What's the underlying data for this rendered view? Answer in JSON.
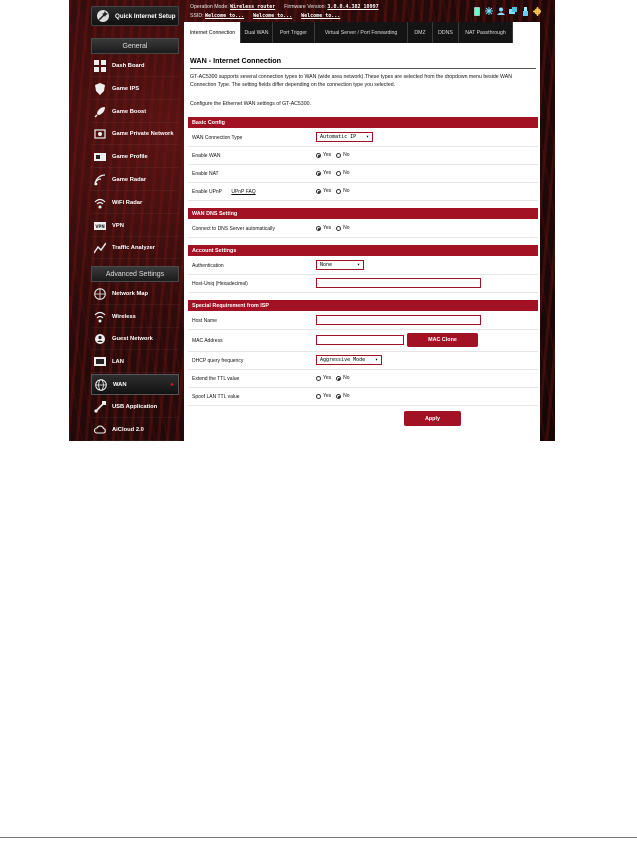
{
  "header": {
    "operation_mode_label": "Operation Mode:",
    "operation_mode_value": "Wireless router",
    "firmware_label": "Firmware Version:",
    "firmware_value": "3.0.0.4.382_10997",
    "ssid_label": "SSID:",
    "ssid_values": [
      "Welcome to...",
      "Welcome to...",
      "Welcome to..."
    ],
    "status_icons": [
      "sim-icon",
      "snowflake-icon",
      "user-icon",
      "network-icon",
      "usb-icon",
      "gear-icon"
    ]
  },
  "sidebar": {
    "quick_setup": "Quick Internet Setup",
    "general_heading": "General",
    "general_items": [
      {
        "label": "Dash Board",
        "icon": "dashboard-icon"
      },
      {
        "label": "Game IPS",
        "icon": "shield-icon"
      },
      {
        "label": "Game Boost",
        "icon": "rocket-icon"
      },
      {
        "label": "Game Private Network",
        "icon": "private-network-icon"
      },
      {
        "label": "Game Profile",
        "icon": "profile-icon"
      },
      {
        "label": "Game Radar",
        "icon": "radar-icon"
      },
      {
        "label": "WiFi Radar",
        "icon": "wifi-radar-icon"
      },
      {
        "label": "VPN",
        "icon": "vpn-icon"
      },
      {
        "label": "Traffic Analyzer",
        "icon": "traffic-icon"
      }
    ],
    "advanced_heading": "Advanced Settings",
    "advanced_items": [
      {
        "label": "Network Map",
        "icon": "network-map-icon"
      },
      {
        "label": "Wireless",
        "icon": "wireless-icon"
      },
      {
        "label": "Guest Network",
        "icon": "guest-network-icon"
      },
      {
        "label": "LAN",
        "icon": "lan-icon"
      },
      {
        "label": "WAN",
        "icon": "globe-icon",
        "active": true
      },
      {
        "label": "USB Application",
        "icon": "usb-app-icon"
      },
      {
        "label": "AiCloud 2.0",
        "icon": "cloud-icon"
      }
    ]
  },
  "tabs": [
    {
      "label": "Internet Connection",
      "active": true
    },
    {
      "label": "Dual WAN"
    },
    {
      "label": "Port Trigger"
    },
    {
      "label": "Virtual Server / Port Forwarding"
    },
    {
      "label": "DMZ"
    },
    {
      "label": "DDNS"
    },
    {
      "label": "NAT Passthrough"
    }
  ],
  "page": {
    "title": "WAN - Internet Connection",
    "description": "GT-AC5300 supports several connection types to WAN (wide area network).These types are selected from the dropdown menu beside WAN Connection Type. The setting fields differ depending on the connection type you selected.",
    "config_note": "Configure the Ethernet WAN settings of GT-AC5300."
  },
  "basic_config": {
    "heading": "Basic Config",
    "wan_connection_type_label": "WAN Connection Type",
    "wan_connection_type_value": "Automatic IP",
    "enable_wan_label": "Enable WAN",
    "enable_nat_label": "Enable NAT",
    "enable_upnp_label": "Enable UPnP",
    "upnp_faq_label": "UPnP FAQ"
  },
  "radio_labels": {
    "yes": "Yes",
    "no": "No"
  },
  "wan_dns": {
    "heading": "WAN DNS Setting",
    "connect_dns_label": "Connect to DNS Server automatically"
  },
  "account": {
    "heading": "Account Settings",
    "authentication_label": "Authentication",
    "authentication_value": "None",
    "host_uniq_label": "Host-Uniq (Hexadecimal)",
    "host_uniq_value": ""
  },
  "isp": {
    "heading": "Special Requirement from ISP",
    "host_name_label": "Host Name",
    "host_name_value": "",
    "mac_address_label": "MAC Address",
    "mac_address_value": "",
    "mac_clone_label": "MAC Clone",
    "dhcp_freq_label": "DHCP query frequency",
    "dhcp_freq_value": "Aggressive Mode",
    "extend_ttl_label": "Extend the TTL value",
    "spoof_ttl_label": "Spoof LAN TTL value"
  },
  "apply_label": "Apply",
  "radio_state": {
    "enable_wan": "yes",
    "enable_nat": "yes",
    "enable_upnp": "yes",
    "connect_dns": "yes",
    "extend_ttl": "no",
    "spoof_ttl": "no"
  }
}
